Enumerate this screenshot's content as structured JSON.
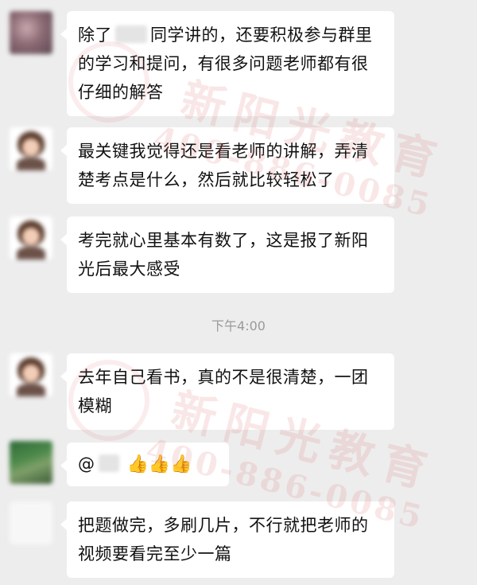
{
  "messages": [
    {
      "pre": "除了",
      "post": "同学讲的，还要积极参与群里的学习和提问，有很多问题老师都有很仔细的解答"
    },
    {
      "text": "最关键我觉得还是看老师的讲解，弄清楚考点是什么，然后就比较轻松了"
    },
    {
      "text": "考完就心里基本有数了，这是报了新阳光后最大感受"
    },
    {
      "text": "去年自己看书，真的不是很清楚，一团模糊"
    },
    {
      "pre": "@",
      "thumbs": "👍👍👍"
    },
    {
      "text": "把题做完，多刷几片，不行就把老师的视频要看完至少一篇"
    }
  ],
  "time_divider": "下午4:00",
  "watermark": {
    "title": "新阳光教育",
    "phone": "400-886-0085"
  },
  "colors": {
    "background": "#ededed",
    "bubble": "#ffffff",
    "watermark": "#de6e6e"
  }
}
